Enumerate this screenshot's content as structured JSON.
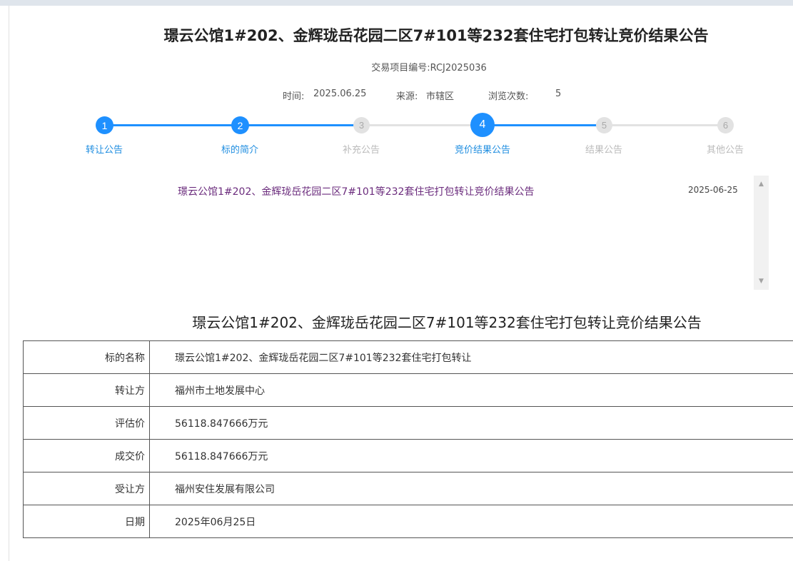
{
  "page": {
    "title": "璟云公馆1#202、金辉珑岳花园二区7#101等232套住宅打包转让竞价结果公告",
    "project_no": "交易项目编号:RCJ2025036",
    "meta": {
      "time_label": "时间:",
      "time_value": "2025.06.25",
      "source_label": "来源:",
      "source_value": "市辖区",
      "views_label": "浏览次数:",
      "views_value": "5"
    }
  },
  "steps": [
    {
      "number": "1",
      "label": "转让公告",
      "state": "active"
    },
    {
      "number": "2",
      "label": "标的简介",
      "state": "active"
    },
    {
      "number": "3",
      "label": "补充公告",
      "state": "inactive"
    },
    {
      "number": "4",
      "label": "竞价结果公告",
      "state": "current"
    },
    {
      "number": "5",
      "label": "结果公告",
      "state": "inactive"
    },
    {
      "number": "6",
      "label": "其他公告",
      "state": "inactive"
    }
  ],
  "announcements": [
    {
      "title": "璟云公馆1#202、金辉珑岳花园二区7#101等232套住宅打包转让竞价结果公告",
      "date": "2025-06-25"
    }
  ],
  "section_title": "璟云公馆1#202、金辉珑岳花园二区7#101等232套住宅打包转让竞价结果公告",
  "details": [
    {
      "key": "标的名称",
      "value": "璟云公馆1#202、金辉珑岳花园二区7#101等232套住宅打包转让"
    },
    {
      "key": "转让方",
      "value": "福州市土地发展中心"
    },
    {
      "key": "评估价",
      "value": "56118.847666万元"
    },
    {
      "key": "成交价",
      "value": "56118.847666万元"
    },
    {
      "key": "受让方",
      "value": "福州安住发展有限公司"
    },
    {
      "key": "日期",
      "value": "2025年06月25日"
    }
  ],
  "colors": {
    "accent": "#1e90ff",
    "inactive": "#e2e2e2",
    "link": "#6b2c7d"
  }
}
